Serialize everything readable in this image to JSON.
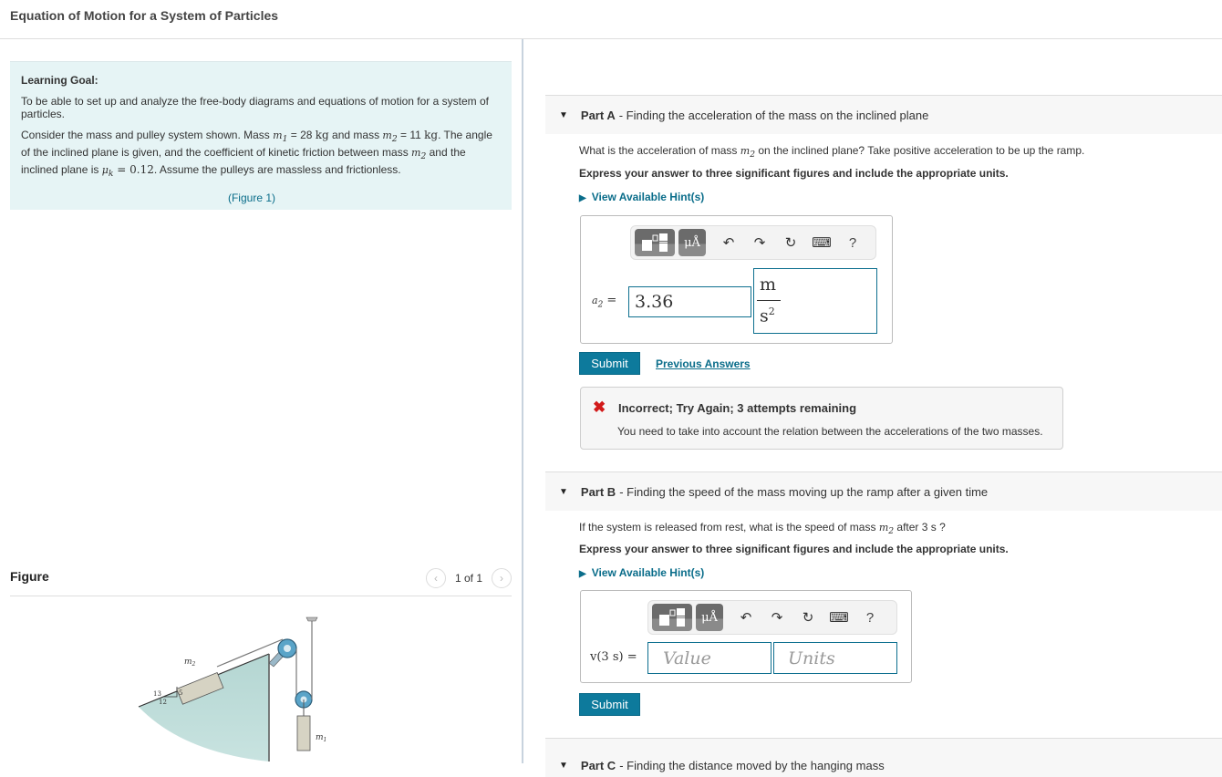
{
  "header": {
    "title": "Equation of Motion for a System of Particles"
  },
  "learning_goal": {
    "title": "Learning Goal:",
    "goal_text": "To be able to set up and analyze the free-body diagrams and equations of motion for a system of particles.",
    "problem_parts": {
      "p1": "Consider the mass and pulley system shown. Mass ",
      "m1_symbol": "m",
      "m1_sub": "1",
      "p2": " = 28 ",
      "unit_kg": "kg",
      "p3": " and mass ",
      "m2_symbol": "m",
      "m2_sub": "2",
      "p4": " = 11 ",
      "p5": ". The angle of the inclined plane is given, and the coefficient of kinetic friction between mass ",
      "p6": " and the inclined plane is ",
      "mu_symbol": "μ",
      "mu_sub": "k",
      "mu_value": " = 0.12",
      "p7": ". Assume the pulleys are massless and frictionless."
    },
    "figure_link": "(Figure 1)"
  },
  "figure": {
    "label": "Figure",
    "pager_text": "1 of 1",
    "prev_icon": "‹",
    "next_icon": "›",
    "diagram_labels": {
      "m2": "m",
      "m2_sub": "2",
      "m1": "m",
      "m1_sub": "1",
      "hyp": "13",
      "rise": "5",
      "run": "12"
    },
    "colors": {
      "ramp": "#b9d8d4",
      "block": "#d6d3c3",
      "pulley": "#5aa4c8"
    }
  },
  "parts": [
    {
      "name": "Part A",
      "title": " - Finding the acceleration of the mass on the inclined plane",
      "question_pre": "What is the acceleration of mass ",
      "question_sym": "m",
      "question_sub": "2",
      "question_post": " on the inclined plane? Take positive acceleration to be up the ramp.",
      "instructions": "Express your answer to three significant figures and include the appropriate units.",
      "hint_label": "View Available Hint(s)",
      "eq_label": "a",
      "eq_sub": "2",
      "eq_equals": " =",
      "value": "3.36",
      "unit_num": "m",
      "unit_den": "s",
      "unit_den_exp": "2",
      "submit_label": "Submit",
      "previous_answers_label": "Previous Answers",
      "feedback": {
        "status_icon": "✖",
        "title": "Incorrect; Try Again; 3 attempts remaining",
        "message": "You need to take into account the relation between the accelerations of the two masses."
      }
    },
    {
      "name": "Part B",
      "title": " - Finding the speed of the mass moving up the ramp after a given time",
      "question_pre": "If the system is released from rest, what is the speed of mass ",
      "question_sym": "m",
      "question_sub": "2",
      "question_post": " after 3  s ?",
      "instructions": "Express your answer to three significant figures and include the appropriate units.",
      "hint_label": "View Available Hint(s)",
      "eq_label": "v(3 s) =",
      "value_placeholder": "Value",
      "units_placeholder": "Units",
      "submit_label": "Submit"
    },
    {
      "name": "Part C",
      "title": " - Finding the distance moved by the hanging mass"
    }
  ],
  "toolbar": {
    "templates_icon": "fraction-template-icon",
    "units_label": "μÅ",
    "undo_icon": "↶",
    "redo_icon": "↷",
    "reset_icon": "↻",
    "keyboard_icon": "⌨",
    "help_label": "?"
  },
  "colors": {
    "accent": "#0d7a9c",
    "link": "#0a6d8a",
    "error": "#d21a1a",
    "goal_bg": "#e6f4f5"
  }
}
